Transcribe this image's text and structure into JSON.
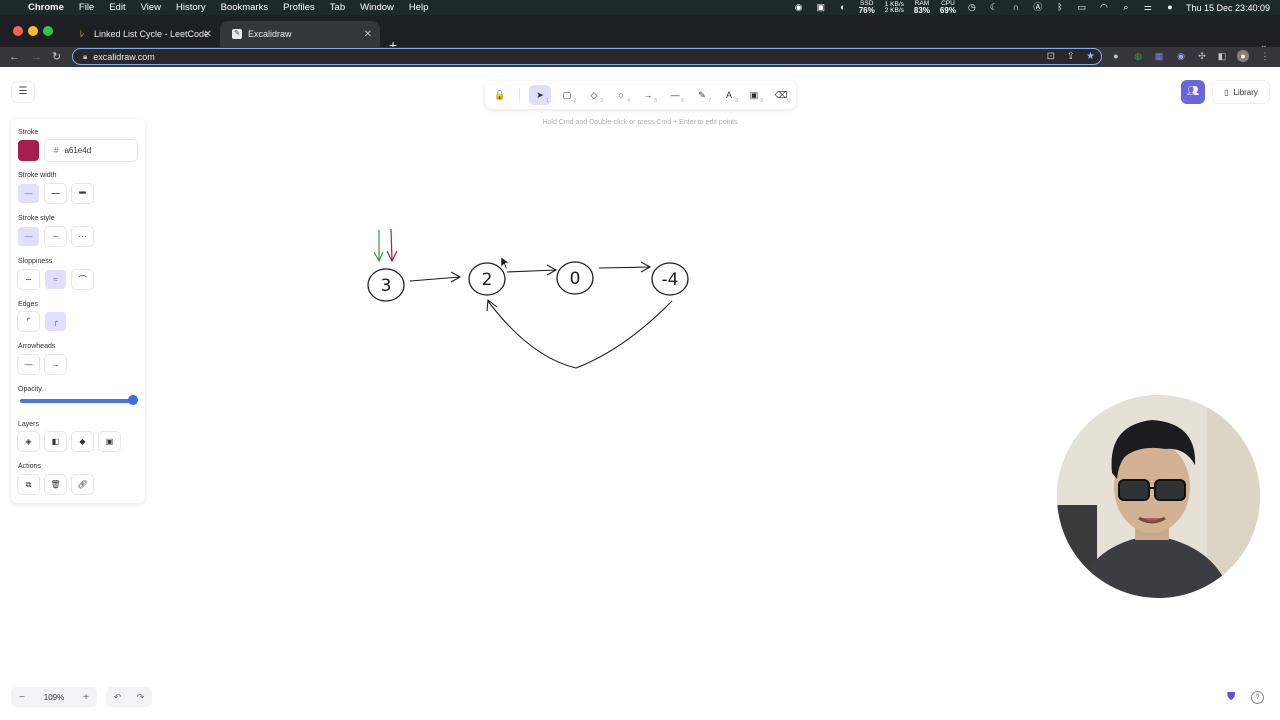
{
  "menubar": {
    "app_name": "Chrome",
    "items": [
      "File",
      "Edit",
      "View",
      "History",
      "Bookmarks",
      "Profiles",
      "Tab",
      "Window",
      "Help"
    ],
    "stats": [
      {
        "top": "SSD",
        "value": "76%"
      },
      {
        "top": "1 KB/s",
        "value": "2 KB/s"
      },
      {
        "top": "RAM",
        "value": "83%"
      },
      {
        "top": "CPU",
        "value": "69%"
      }
    ],
    "clock": "Thu 15 Dec  23:40:09"
  },
  "browser": {
    "tabs": [
      {
        "title": "Linked List Cycle - LeetCode",
        "active": false,
        "icon": "leetcode-icon"
      },
      {
        "title": "Excalidraw",
        "active": true,
        "icon": "excalidraw-icon"
      }
    ],
    "new_tab_label": "+",
    "url": "excalidraw.com"
  },
  "excalidraw": {
    "tools": [
      {
        "name": "lock-tool",
        "glyph": "🔓",
        "shortcut": ""
      },
      {
        "name": "selection-tool",
        "glyph": "➤",
        "shortcut": "1",
        "selected": true
      },
      {
        "name": "rectangle-tool",
        "glyph": "▢",
        "shortcut": "2"
      },
      {
        "name": "diamond-tool",
        "glyph": "◇",
        "shortcut": "3"
      },
      {
        "name": "ellipse-tool",
        "glyph": "○",
        "shortcut": "4"
      },
      {
        "name": "arrow-tool",
        "glyph": "→",
        "shortcut": "5"
      },
      {
        "name": "line-tool",
        "glyph": "—",
        "shortcut": "6"
      },
      {
        "name": "draw-tool",
        "glyph": "✎",
        "shortcut": "7"
      },
      {
        "name": "text-tool",
        "glyph": "A",
        "shortcut": "8"
      },
      {
        "name": "image-tool",
        "glyph": "▣",
        "shortcut": "9"
      },
      {
        "name": "eraser-tool",
        "glyph": "⌫",
        "shortcut": "0"
      }
    ],
    "hint": "Hold Cmd and Double-click or press Cmd + Enter to edit points",
    "library_label": "Library",
    "properties": {
      "stroke_label": "Stroke",
      "stroke_color": "#a61e4d",
      "stroke_hex": "a61e4d",
      "stroke_width_label": "Stroke width",
      "stroke_style_label": "Stroke style",
      "sloppiness_label": "Sloppiness",
      "edges_label": "Edges",
      "arrowheads_label": "Arrowheads",
      "opacity_label": "Opacity",
      "opacity_value": 100,
      "layers_label": "Layers",
      "actions_label": "Actions"
    },
    "nodes": [
      "3",
      "2",
      "0",
      "-4"
    ],
    "pointer_colors": [
      "#2f9e44",
      "#a61e4d"
    ],
    "zoom": "109%",
    "zoom_out": "−",
    "zoom_in": "+"
  }
}
